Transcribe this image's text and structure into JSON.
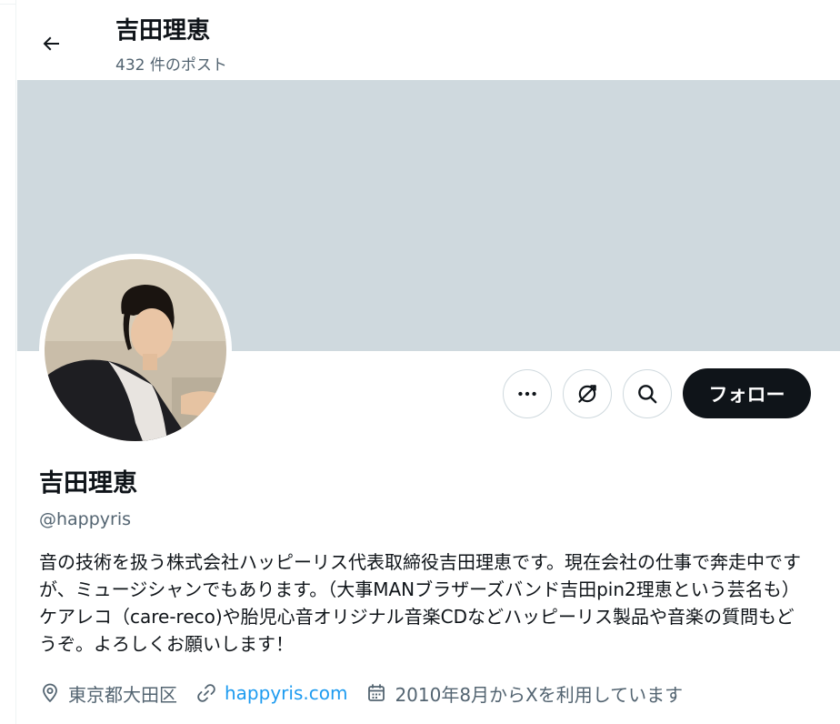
{
  "header": {
    "name": "吉田理恵",
    "post_count": "432 件のポスト"
  },
  "profile": {
    "display_name": "吉田理恵",
    "handle": "@happyris",
    "bio": "音の技術を扱う株式会社ハッピーリス代表取締役吉田理恵です。現在会社の仕事で奔走中ですが、ミュージシャンでもあります。（大事MANブラザーズバンド吉田pin2理恵という芸名も）ケアレコ（care-reco)や胎児心音オリジナル音楽CDなどハッピーリス製品や音楽の質問もどうぞ。よろしくお願いします！",
    "location": "東京都大田区",
    "website": "happyris.com",
    "joined": "2010年8月からXを利用しています"
  },
  "actions": {
    "follow_label": "フォロー"
  },
  "icons": {
    "back": "arrow-left-icon",
    "more": "more-horizontal-icon",
    "subscribe": "subscribe-icon",
    "search": "search-icon",
    "location": "location-pin-icon",
    "link": "link-icon",
    "calendar": "calendar-icon"
  },
  "colors": {
    "banner": "#cfd9de",
    "text_primary": "#0f1419",
    "text_secondary": "#536471",
    "link": "#1d9bf0",
    "follow_button_bg": "#0f1419"
  }
}
